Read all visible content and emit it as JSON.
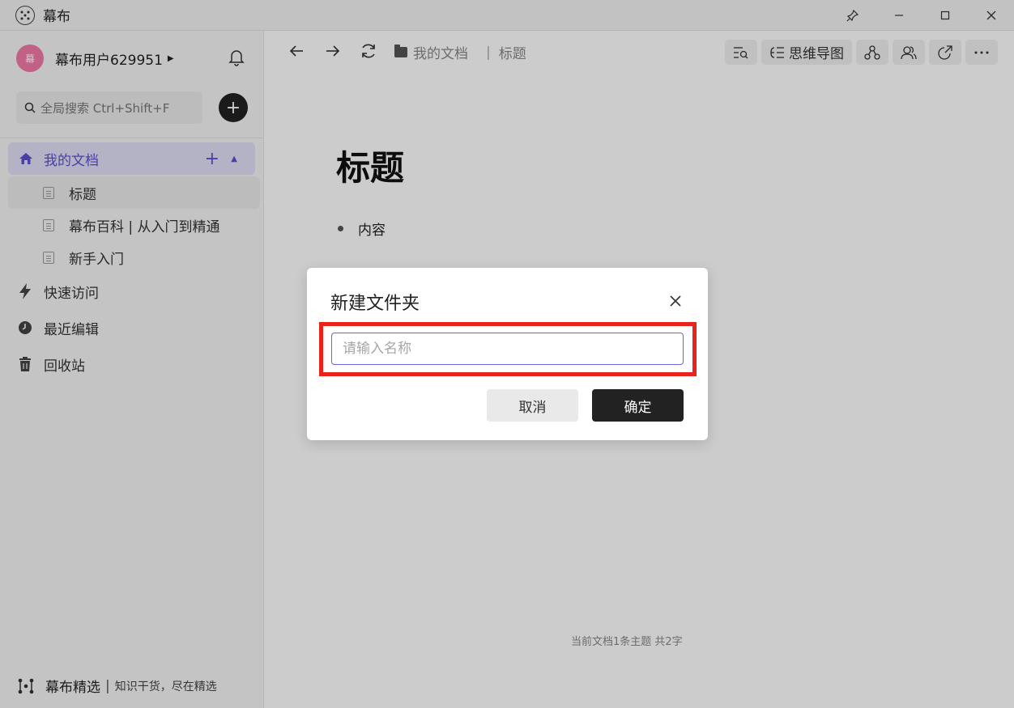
{
  "window": {
    "title": "幕布",
    "logo_icon": "mubu-logo-icon",
    "controls": [
      "pin-icon",
      "minimize-icon",
      "maximize-icon",
      "close-icon"
    ]
  },
  "sidebar": {
    "user": {
      "avatar_text": "幕",
      "name": "幕布用户629951",
      "avatar_color": "#f07aa7"
    },
    "search_placeholder": "全局搜索 Ctrl+Shift+F",
    "mydocs": {
      "label": "我的文档",
      "accent": "#5a4fd1"
    },
    "docs": [
      {
        "label": "标题",
        "active": true
      },
      {
        "label": "幕布百科 | 从入门到精通",
        "active": false
      },
      {
        "label": "新手入门",
        "active": false
      }
    ],
    "nav": [
      {
        "label": "快速访问",
        "icon": "lightning-icon"
      },
      {
        "label": "最近编辑",
        "icon": "clock-icon"
      },
      {
        "label": "回收站",
        "icon": "trash-icon"
      }
    ],
    "footer": {
      "name": "幕布精选",
      "slogan": "知识干货，尽在精选"
    }
  },
  "main": {
    "breadcrumb": {
      "folder": "我的文档",
      "current": "标题"
    },
    "toolbar": {
      "mindmap_label": "思维导图"
    },
    "doc_title": "标题",
    "bullets": [
      "内容"
    ],
    "status": "当前文档1条主题 共2字"
  },
  "dialog": {
    "title": "新建文件夹",
    "input_placeholder": "请输入名称",
    "input_value": "",
    "cancel_label": "取消",
    "ok_label": "确定",
    "highlight_color": "#e8231c"
  }
}
